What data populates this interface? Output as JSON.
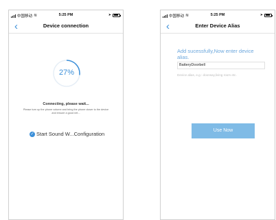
{
  "status_bar": {
    "carrier": "中国移动",
    "time": "5:25 PM"
  },
  "screen1": {
    "title": "Device connection",
    "progress_text": "27%",
    "progress_value": 27,
    "status_title": "Connecting, please wait...",
    "status_note": "Please turn up the phone volume and bring the phone closer to the device and ensure a good net...",
    "sound_option_label": "Start Sound W...Configuration",
    "sound_option_checked": true
  },
  "screen2": {
    "title": "Enter Device Alias",
    "prompt": "Add sucessfully,Now enter device alias.",
    "alias_value": "BatteryDoorbell",
    "alias_hint": "Device alias, e.g.: doorway,living room etc.",
    "button_label": "Use Now"
  },
  "colors": {
    "accent": "#3b8fd9",
    "button": "#7fbbe6",
    "prompt_text": "#6aa6dc"
  },
  "icons": [
    "signal-icon",
    "wifi-icon",
    "location-icon",
    "battery-icon",
    "back-chevron-icon",
    "check-circle-icon"
  ]
}
